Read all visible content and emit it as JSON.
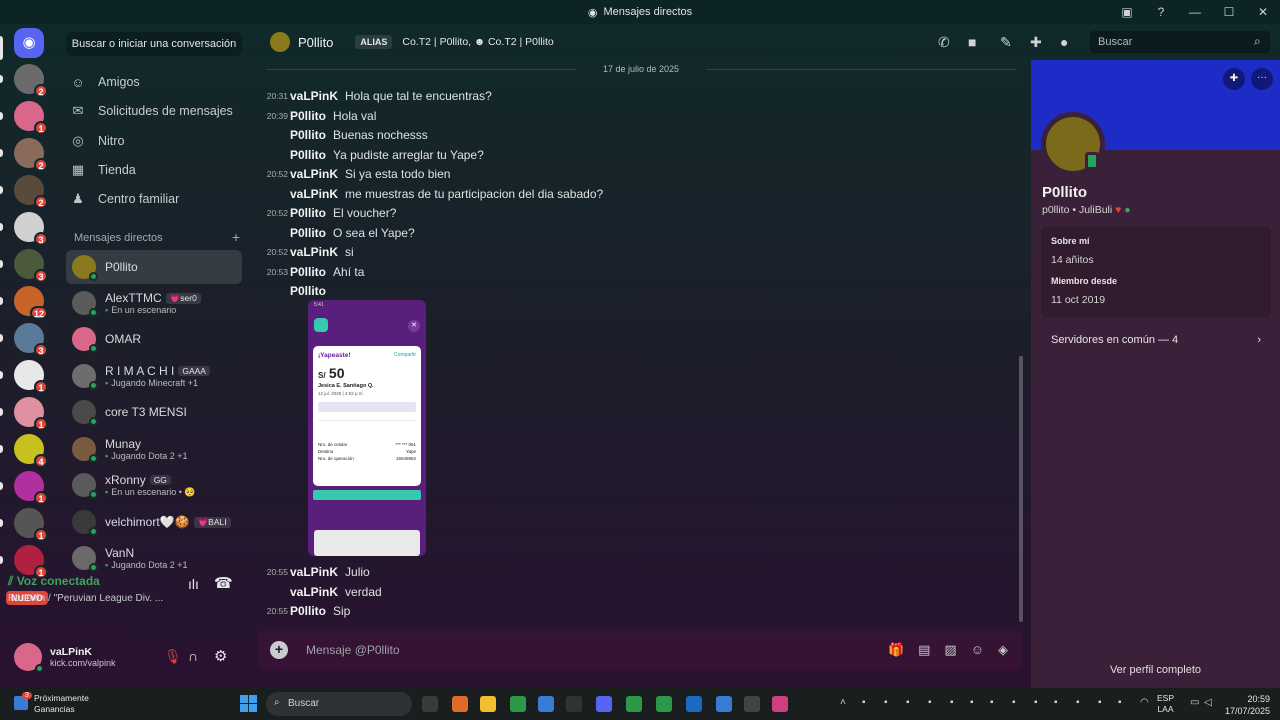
{
  "window": {
    "title": "Mensajes directos"
  },
  "sidebar": {
    "search_label": "Buscar o iniciar una conversación",
    "nav": [
      {
        "label": "Amigos",
        "icon": "friends-icon",
        "glyph": "☺"
      },
      {
        "label": "Solicitudes de mensajes",
        "icon": "envelope-icon",
        "glyph": "✉"
      },
      {
        "label": "Nitro",
        "icon": "nitro-icon",
        "glyph": "◎"
      },
      {
        "label": "Tienda",
        "icon": "shop-icon",
        "glyph": "▦"
      },
      {
        "label": "Centro familiar",
        "icon": "family-icon",
        "glyph": "♟"
      }
    ],
    "dm_header": "Mensajes directos",
    "dms": [
      {
        "name": "P0llito",
        "tag": "",
        "sub": "",
        "color": "#8a7a1c",
        "active": true
      },
      {
        "name": "AlexTTMC",
        "tag": "💗ser0",
        "sub": "En un escenario",
        "color": "#5b5b5b"
      },
      {
        "name": "OMAR",
        "tag": "",
        "sub": "",
        "color": "#d9678a"
      },
      {
        "name": "R I M A C H I",
        "tag": "GAAA",
        "sub": "Jugando Minecraft +1",
        "color": "#6d6d6d"
      },
      {
        "name": "core T3 MENSI",
        "tag": "",
        "sub": "",
        "color": "#4a4a4a"
      },
      {
        "name": "Munay",
        "tag": "",
        "sub": "Jugando Dota 2 +1",
        "color": "#7a5a40"
      },
      {
        "name": "xRonny",
        "tag": "GG",
        "sub": "En un escenario • 🥺",
        "color": "#5a5a5a"
      },
      {
        "name": "velchimort🤍🍪",
        "tag": "💗BALI",
        "sub": "",
        "color": "#3a3a3a"
      },
      {
        "name": "VanN",
        "tag": "",
        "sub": "Jugando Dota 2 +1",
        "color": "#6a6a6a"
      }
    ],
    "voice": {
      "status": "Voz conectada",
      "channel": "Reunión / \"Peruvian League Div. ..."
    },
    "user": {
      "name": "vaLPinK",
      "status": "kick.com/valpink"
    }
  },
  "servers": [
    {
      "color": "#6b6b6b",
      "badge": "2"
    },
    {
      "color": "#d9678a",
      "badge": "1"
    },
    {
      "color": "#8a6a5a",
      "badge": "2"
    },
    {
      "color": "#5a4a3a",
      "badge": "2"
    },
    {
      "color": "#d0d0d0",
      "badge": "3"
    },
    {
      "color": "#4a5a3a",
      "badge": "3"
    },
    {
      "color": "#c8642a",
      "badge": "12"
    },
    {
      "color": "#5a7a9a",
      "badge": "3"
    },
    {
      "color": "#e8e8e8",
      "badge": "1"
    },
    {
      "color": "#e090a0",
      "badge": "1"
    },
    {
      "color": "#c8c020",
      "badge": "4"
    },
    {
      "color": "#b030a0",
      "badge": "1"
    },
    {
      "color": "#555555",
      "badge": "1"
    },
    {
      "color": "#b02040",
      "badge": "1"
    }
  ],
  "servers_new_label": "NUEVO",
  "chat": {
    "title": "P0llito",
    "alias_label": "ALIAS",
    "alias_text": "Co.T2 | P0llito, ☻ Co.T2 | P0llito",
    "search_placeholder": "Buscar",
    "date_divider": "17 de julio de 2025",
    "messages": [
      {
        "time": "20:31",
        "author": "vaLPinK",
        "text": "Hola que tal te encuentras?"
      },
      {
        "time": "20:39",
        "author": "P0llito",
        "text": "Hola val"
      },
      {
        "time": "",
        "author": "P0llito",
        "text": "Buenas nochesss"
      },
      {
        "time": "",
        "author": "P0llito",
        "text": "Ya pudiste arreglar tu Yape?"
      },
      {
        "time": "20:52",
        "author": "vaLPinK",
        "text": "Si ya esta todo bien"
      },
      {
        "time": "",
        "author": "vaLPinK",
        "text": "me muestras de tu participacion del dia sabado?"
      },
      {
        "time": "20:52",
        "author": "P0llito",
        "text": "El voucher?"
      },
      {
        "time": "",
        "author": "P0llito",
        "text": "O sea el Yape?"
      },
      {
        "time": "20:52",
        "author": "vaLPinK",
        "text": "si"
      },
      {
        "time": "20:53",
        "author": "P0llito",
        "text": "Ahí ta"
      },
      {
        "time": "",
        "author": "P0llito",
        "text": ""
      }
    ],
    "after_messages": [
      {
        "time": "20:55",
        "author": "vaLPinK",
        "text": "Julio"
      },
      {
        "time": "",
        "author": "vaLPinK",
        "text": "verdad"
      },
      {
        "time": "20:55",
        "author": "P0llito",
        "text": "Sip"
      }
    ],
    "attachment": {
      "heading": "¡Yapeaste!",
      "share": "Compartir",
      "amount_prefix": "S/",
      "amount": "50",
      "recipient": "Jesica E. Santiago Q.",
      "date": "12 jul. 2025 | 4:52 p.m.",
      "field1_label": "Nro. de celular",
      "field1_value": "*** *** 061",
      "field2_label": "Destino",
      "field2_value": "Yape",
      "field3_label": "Nro. de operación",
      "field3_value": "16549852"
    },
    "input_placeholder": "Mensaje @P0llito"
  },
  "profile": {
    "name": "P0llito",
    "handle": "p0llito • JuliBuli",
    "about_label": "Sobre mí",
    "about_value": "14 añitos",
    "member_label": "Miembro desde",
    "member_value": "11 oct 2019",
    "common_label": "Servidores en común — 4",
    "full_profile": "Ver perfil completo"
  },
  "taskbar": {
    "weather_line1": "Próximamente",
    "weather_line2": "Ganancias",
    "weather_badge": "3",
    "search_label": "Buscar",
    "lang1": "ESP",
    "lang2": "LAA",
    "time": "20:59",
    "date": "17/07/2025"
  }
}
